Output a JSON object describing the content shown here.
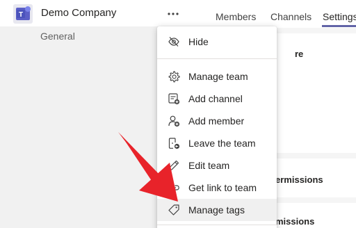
{
  "team": {
    "name": "Demo Company",
    "channel": "General"
  },
  "tabs": [
    {
      "label": "Members"
    },
    {
      "label": "Channels"
    },
    {
      "label": "Settings"
    }
  ],
  "cards": [
    {
      "text": "re"
    },
    {
      "text": "ermissions"
    },
    {
      "text": "missions"
    }
  ],
  "menu": {
    "items": [
      {
        "label": "Hide",
        "icon": "hide-icon"
      },
      {
        "label": "Manage team",
        "icon": "gear-icon"
      },
      {
        "label": "Add channel",
        "icon": "add-channel-icon"
      },
      {
        "label": "Add member",
        "icon": "add-member-icon"
      },
      {
        "label": "Leave the team",
        "icon": "leave-icon"
      },
      {
        "label": "Edit team",
        "icon": "pencil-icon"
      },
      {
        "label": "Get link to team",
        "icon": "link-icon"
      },
      {
        "label": "Manage tags",
        "icon": "tag-icon"
      }
    ]
  },
  "colors": {
    "accent": "#6264a7",
    "arrow": "#e8232a",
    "teams_logo": "#5b5fc7"
  }
}
